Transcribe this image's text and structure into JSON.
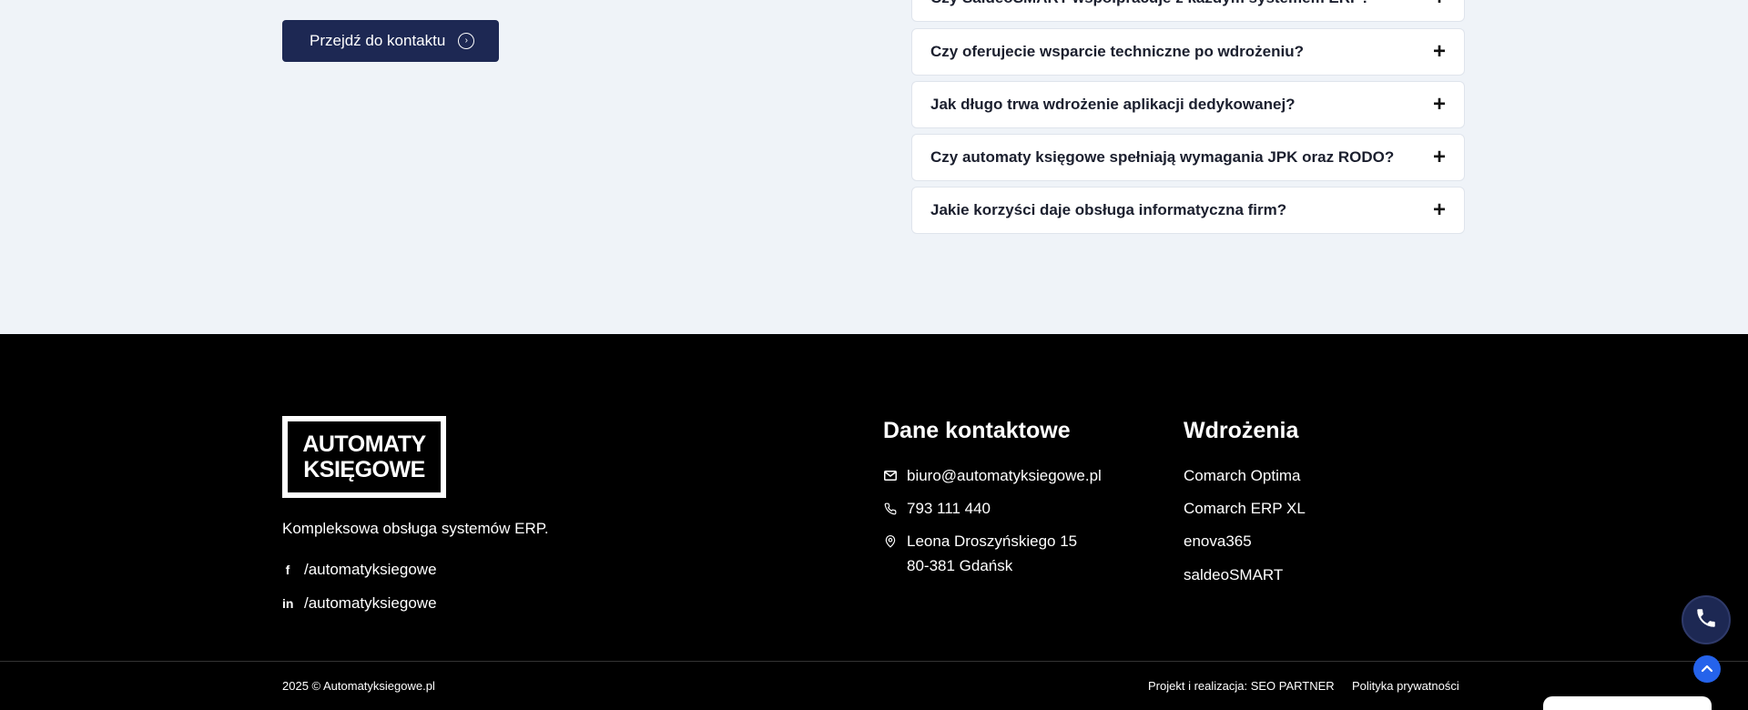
{
  "cta": {
    "label": "Przejdź do kontaktu"
  },
  "faq": {
    "items": [
      {
        "question": "Czy SaldeoSMART współpracuje z każdym systemem ERP?"
      },
      {
        "question": "Czy oferujecie wsparcie techniczne po wdrożeniu?"
      },
      {
        "question": "Jak długo trwa wdrożenie aplikacji dedykowanej?"
      },
      {
        "question": "Czy automaty księgowe spełniają wymagania JPK oraz RODO?"
      },
      {
        "question": "Jakie korzyści daje obsługa informatyczna firm?"
      }
    ]
  },
  "footer": {
    "logo": {
      "line1": "AUTOMATY",
      "line2": "KSIĘGOWE"
    },
    "tagline": "Kompleksowa obsługa systemów ERP.",
    "social": {
      "facebook": "/automatyksiegowe",
      "linkedin": "/automatyksiegowe"
    },
    "contact": {
      "title": "Dane kontaktowe",
      "email": "biuro@automatyksiegowe.pl",
      "phone": "793 111 440",
      "address_line1": "Leona Droszyńskiego 15",
      "address_line2": "80-381 Gdańsk"
    },
    "implementations": {
      "title": "Wdrożenia",
      "items": [
        "Comarch Optima",
        "Comarch ERP XL",
        "enova365",
        "saldeoSMART"
      ]
    },
    "copyright": "2025 © Automatyksiegowe.pl",
    "credits": "Projekt i realizacja: SEO PARTNER",
    "privacy": "Polityka prywatności"
  },
  "colors": {
    "navy": "#1d2853",
    "background": "#eff3f8",
    "accent_blue": "#2563eb"
  }
}
